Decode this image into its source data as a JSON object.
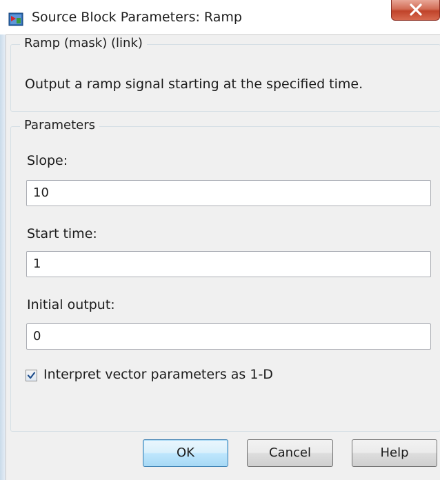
{
  "window": {
    "title": "Source Block Parameters: Ramp",
    "close_icon": "close-icon",
    "app_icon": "simulink-block-icon"
  },
  "description_group": {
    "legend": "Ramp (mask) (link)",
    "text": "Output a ramp signal starting at the specified time."
  },
  "parameters_group": {
    "legend": "Parameters",
    "fields": [
      {
        "label": "Slope:",
        "value": "10"
      },
      {
        "label": "Start time:",
        "value": "1"
      },
      {
        "label": "Initial output:",
        "value": "0"
      }
    ],
    "checkbox": {
      "label": "Interpret vector parameters as 1-D",
      "checked": true
    }
  },
  "buttons": {
    "ok": "OK",
    "cancel": "Cancel",
    "help": "Help"
  },
  "colors": {
    "close_button": "#c0432a",
    "dialog_background": "#f0f0f0",
    "default_button_border": "#3c7fb1"
  }
}
